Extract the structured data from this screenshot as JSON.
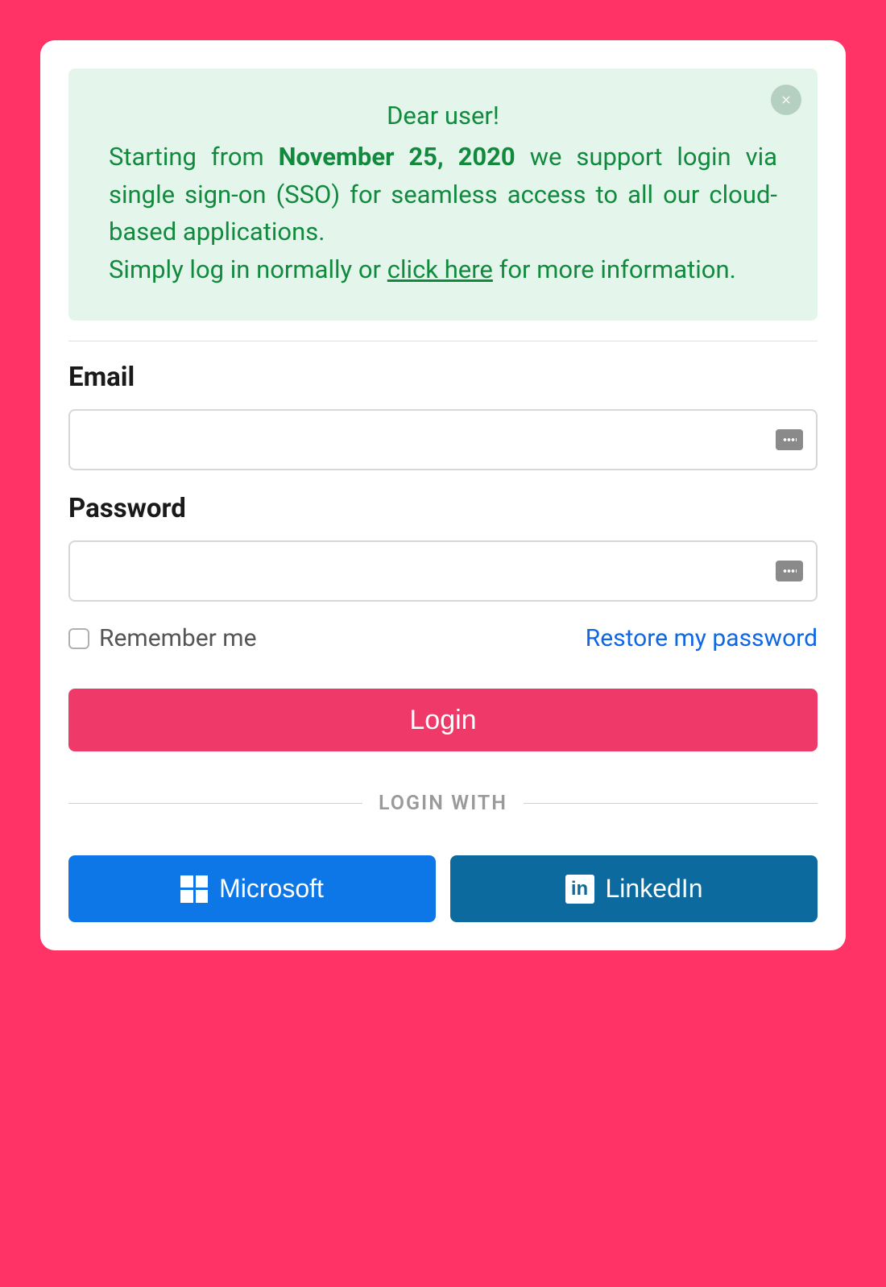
{
  "alert": {
    "title": "Dear user!",
    "body_prefix": "Starting from ",
    "body_bold": "November 25, 2020",
    "body_after_bold": " we support login via single sign-on (SSO) for seamless access to all our cloud-based applications.",
    "body_line2_prefix": "Simply log in normally or ",
    "body_link": "click here",
    "body_line2_suffix": " for more information."
  },
  "form": {
    "email_label": "Email",
    "password_label": "Password",
    "remember_label": "Remember me",
    "restore_link": "Restore my password",
    "login_button": "Login"
  },
  "social": {
    "divider_label": "LOGIN WITH",
    "microsoft_label": "Microsoft",
    "linkedin_label": "LinkedIn"
  }
}
